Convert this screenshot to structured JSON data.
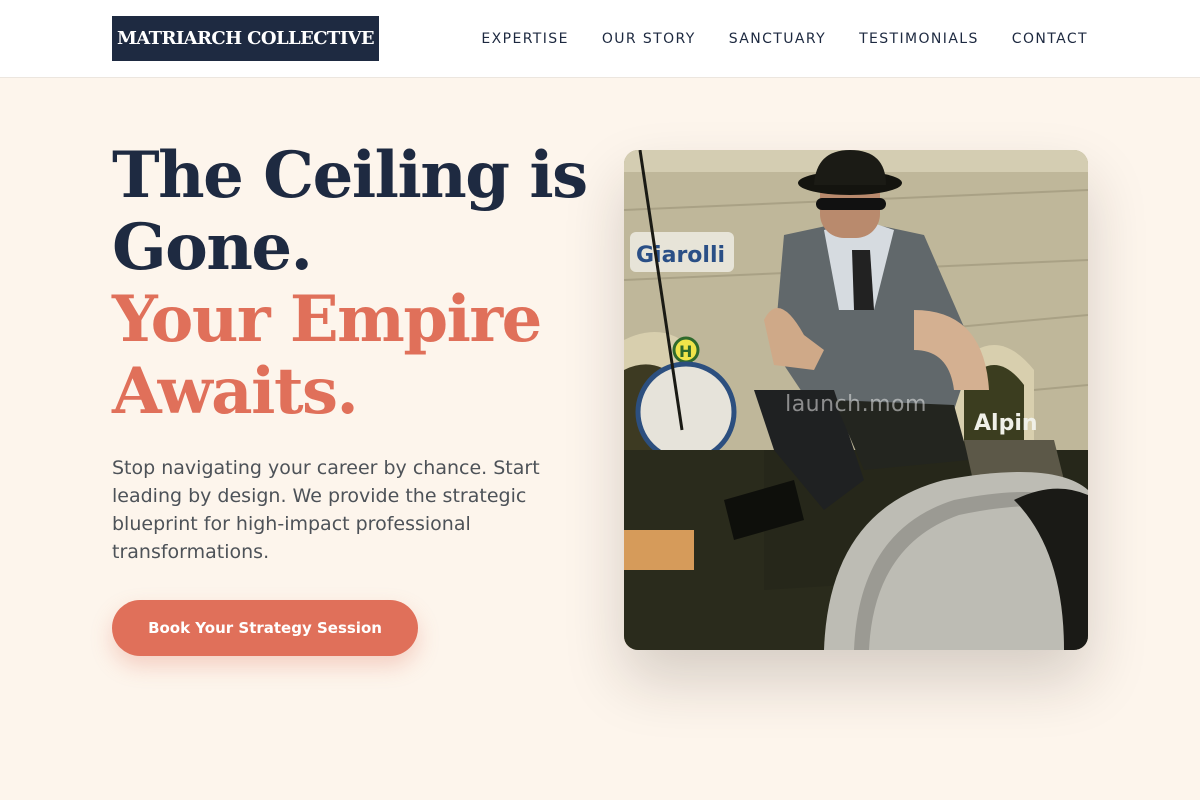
{
  "brand": {
    "logo_text": "MATRIARCH COLLECTIVE"
  },
  "nav": {
    "items": [
      {
        "label": "EXPERTISE"
      },
      {
        "label": "OUR STORY"
      },
      {
        "label": "SANCTUARY"
      },
      {
        "label": "TESTIMONIALS"
      },
      {
        "label": "CONTACT"
      }
    ]
  },
  "hero": {
    "headline_lines": [
      "The Ceiling is",
      "Gone."
    ],
    "accent_lines": [
      "Your Empire",
      "Awaits."
    ],
    "subtext": "Stop navigating your career by chance. Start leading by design. We provide the strategic blueprint for high-impact professional transformations.",
    "cta_label": "Book Your Strategy Session",
    "image": {
      "watermark": "launch.mom",
      "sign_left": "Giarolli",
      "sign_right": "Alpin",
      "sign_h": "H"
    }
  },
  "colors": {
    "navy": "#1e2a41",
    "accent": "#e0705a",
    "background": "#fdf5ec"
  }
}
